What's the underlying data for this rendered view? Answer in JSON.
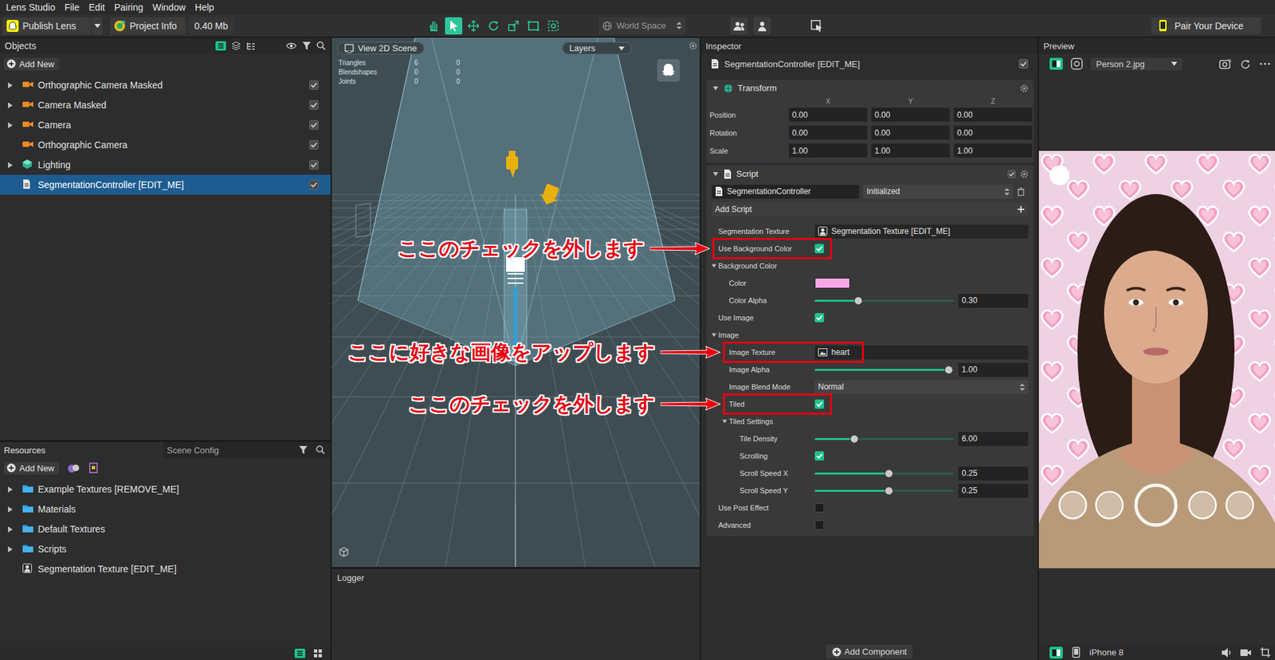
{
  "menu": [
    {
      "label": "Lens Studio"
    },
    {
      "label": "File"
    },
    {
      "label": "Edit"
    },
    {
      "label": "Pairing"
    },
    {
      "label": "Window"
    },
    {
      "label": "Help"
    }
  ],
  "toolbar": {
    "publish": "Publish Lens",
    "project_info": "Project Info",
    "size": "0.40 Mb",
    "space": "World Space",
    "pair": "Pair Your Device",
    "tools": [
      {
        "kind": "hand",
        "selected": false
      },
      {
        "kind": "select",
        "selected": true
      },
      {
        "kind": "move",
        "selected": false
      },
      {
        "kind": "rotate",
        "selected": false
      },
      {
        "kind": "scale",
        "selected": false
      },
      {
        "kind": "rect",
        "selected": false
      },
      {
        "kind": "pivot",
        "selected": false
      }
    ]
  },
  "objects": {
    "title": "Objects",
    "add_new": "Add New",
    "items": [
      {
        "label": "Orthographic Camera Masked",
        "kind": "camera",
        "expandable": true,
        "enabled": true,
        "selected": false
      },
      {
        "label": "Camera Masked",
        "kind": "camera",
        "expandable": true,
        "enabled": true,
        "selected": false
      },
      {
        "label": "Camera",
        "kind": "camera",
        "expandable": true,
        "enabled": true,
        "selected": false
      },
      {
        "label": "Orthographic Camera",
        "kind": "camera",
        "expandable": false,
        "enabled": true,
        "selected": false
      },
      {
        "label": "Lighting",
        "kind": "light",
        "expandable": true,
        "enabled": true,
        "selected": false
      },
      {
        "label": "SegmentationController [EDIT_ME]",
        "kind": "script",
        "expandable": false,
        "enabled": true,
        "selected": true
      }
    ]
  },
  "resources": {
    "tabs": [
      {
        "label": "Resources",
        "selected": true
      },
      {
        "label": "Scene Config",
        "selected": false
      }
    ],
    "add_new": "Add New",
    "items": [
      {
        "label": "Example Textures [REMOVE_ME]",
        "kind": "folder",
        "expandable": true
      },
      {
        "label": "Materials",
        "kind": "folder",
        "expandable": true
      },
      {
        "label": "Default Textures",
        "kind": "folder",
        "expandable": true
      },
      {
        "label": "Scripts",
        "kind": "folder",
        "expandable": true
      },
      {
        "label": "Segmentation Texture [EDIT_ME]",
        "kind": "texture",
        "expandable": false
      }
    ]
  },
  "viewport": {
    "view2d": "View 2D Scene",
    "layers": "Layers",
    "stats": [
      {
        "label": "Triangles",
        "a": "6",
        "b": "0"
      },
      {
        "label": "Blendshapes",
        "a": "0",
        "b": "0"
      },
      {
        "label": "Joints",
        "a": "0",
        "b": "0"
      }
    ]
  },
  "logger": {
    "title": "Logger"
  },
  "inspector": {
    "title": "Inspector",
    "object": {
      "label": "SegmentationController [EDIT_ME]",
      "enabled": true
    },
    "transform": {
      "title": "Transform",
      "expanded": true,
      "axes": [
        "X",
        "Y",
        "Z"
      ],
      "rows": [
        {
          "label": "Position",
          "values": [
            "0.00",
            "0.00",
            "0.00"
          ]
        },
        {
          "label": "Rotation",
          "values": [
            "0.00",
            "0.00",
            "0.00"
          ]
        },
        {
          "label": "Scale",
          "values": [
            "1.00",
            "1.00",
            "1.00"
          ]
        }
      ]
    },
    "script": {
      "title": "Script",
      "expanded": true,
      "enabled": true,
      "name": "SegmentationController",
      "status": "Initialized",
      "add_script": "Add Script"
    },
    "properties": [
      {
        "kind": "texture",
        "label": "Segmentation Texture",
        "value": "Segmentation Texture [EDIT_ME]",
        "depth": 0
      },
      {
        "kind": "checkbox",
        "label": "Use Background Color",
        "checked": true,
        "depth": 0
      },
      {
        "kind": "group",
        "label": "Background Color",
        "expanded": true,
        "depth": 0
      },
      {
        "kind": "color",
        "label": "Color",
        "color": "#f7a7e7",
        "depth": 1
      },
      {
        "kind": "slider",
        "label": "Color Alpha",
        "level": 0.31,
        "reading": "0.30",
        "depth": 1
      },
      {
        "kind": "checkbox",
        "label": "Use Image",
        "checked": true,
        "depth": 0
      },
      {
        "kind": "group",
        "label": "Image",
        "expanded": true,
        "depth": 0
      },
      {
        "kind": "texture",
        "label": "Image Texture",
        "value": "heart",
        "depth": 1
      },
      {
        "kind": "slider",
        "label": "Image Alpha",
        "level": 0.96,
        "reading": "1.00",
        "depth": 1
      },
      {
        "kind": "dropdown",
        "label": "Image Blend Mode",
        "value": "Normal",
        "depth": 1
      },
      {
        "kind": "checkbox",
        "label": "Tiled",
        "checked": true,
        "depth": 1
      },
      {
        "kind": "group",
        "label": "Tiled Settings",
        "expanded": true,
        "depth": 1
      },
      {
        "kind": "slider",
        "label": "Tile Density",
        "level": 0.28,
        "reading": "6.00",
        "depth": 2
      },
      {
        "kind": "checkbox",
        "label": "Scrolling",
        "checked": true,
        "depth": 2
      },
      {
        "kind": "slider",
        "label": "Scroll Speed X",
        "level": 0.53,
        "reading": "0.25",
        "depth": 2
      },
      {
        "kind": "slider",
        "label": "Scroll Speed Y",
        "level": 0.53,
        "reading": "0.25",
        "depth": 2
      },
      {
        "kind": "checkbox",
        "label": "Use Post Effect",
        "checked": false,
        "depth": 0
      },
      {
        "kind": "checkbox",
        "label": "Advanced",
        "checked": false,
        "depth": 0
      }
    ],
    "add_component": "Add Component"
  },
  "preview": {
    "title": "Preview",
    "source": "Person 2.jpg",
    "device": "iPhone 8"
  },
  "annotations": [
    {
      "text": "ここのチェックを外します",
      "target": "Use Background Color"
    },
    {
      "text": "ここに好きな画像をアップします",
      "target": "Image Texture"
    },
    {
      "text": "ここのチェックを外します",
      "target": "Tiled"
    }
  ]
}
